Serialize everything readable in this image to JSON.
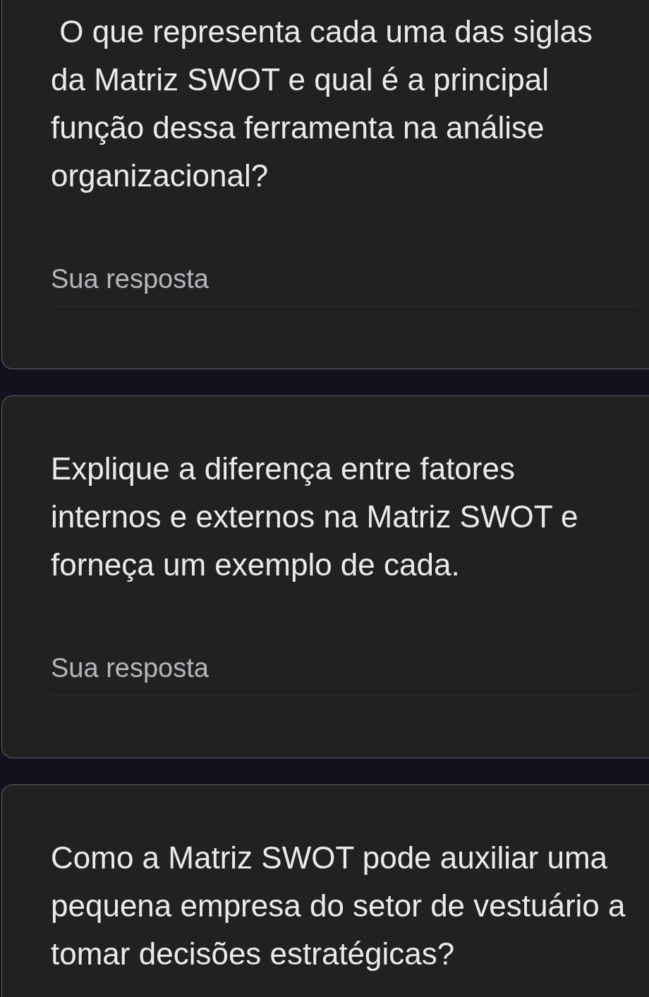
{
  "questions": [
    {
      "text": " O que representa cada uma das siglas da Matriz SWOT e qual é a principal função dessa ferramenta na análise organizacional?",
      "answer": {
        "placeholder": "Sua resposta"
      }
    },
    {
      "text": "Explique a diferença entre fatores internos e externos na Matriz SWOT e forneça um exemplo de cada.",
      "answer": {
        "placeholder": "Sua resposta"
      }
    },
    {
      "text": "Como a Matriz SWOT pode auxiliar uma pequena empresa do setor de vestuário a tomar decisões estratégicas?"
    }
  ]
}
